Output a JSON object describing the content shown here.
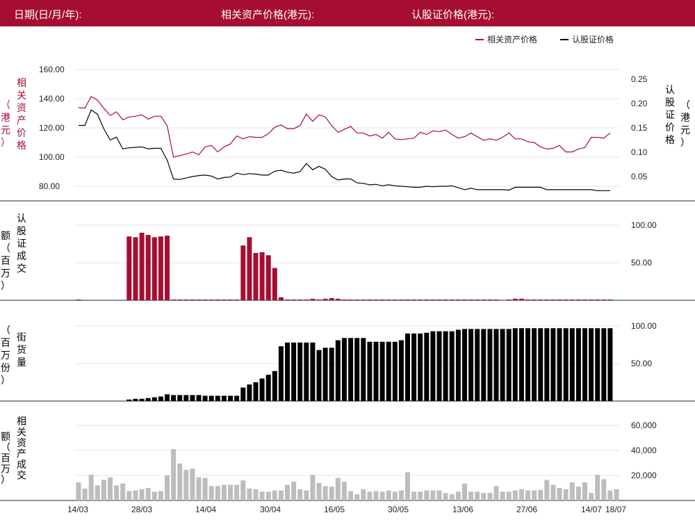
{
  "header": {
    "date_label": "日期(日/月/年):",
    "asset_label": "相关资产价格(港元):",
    "warrant_label": "认股证价格(港元):"
  },
  "colors": {
    "brand": "#a50e32",
    "black": "#000000",
    "gray": "#bdbdbd"
  },
  "chart_data": [
    {
      "type": "line",
      "title": "",
      "legend": {
        "placement": "top-right",
        "entries": [
          "相关资产价格",
          "认股证价格"
        ]
      },
      "ylabel_left": "相关资产价格（港元）",
      "ylabel_right": "认股证价格（港元）",
      "yticks_left": [
        "80.00",
        "100.00",
        "120.00",
        "140.00",
        "160.00"
      ],
      "yticks_right": [
        "0.05",
        "0.10",
        "0.15",
        "0.20",
        "0.25"
      ],
      "ylim_left": [
        70,
        170
      ],
      "ylim_right": [
        0,
        0.3
      ],
      "grid": true,
      "series": [
        {
          "name": "相关资产价格",
          "axis": "left",
          "color": "#a50e32",
          "values": [
            134,
            133.5,
            141.5,
            139,
            133.5,
            128.5,
            131,
            125.5,
            127.5,
            128,
            129,
            126,
            128,
            128,
            121.5,
            100,
            101,
            102,
            103.5,
            101.5,
            107,
            108,
            103.5,
            107,
            109,
            114.5,
            112.5,
            114,
            113.5,
            113.5,
            116,
            120.5,
            122,
            119.5,
            119.5,
            121.5,
            129.5,
            124.5,
            129,
            127.5,
            121.5,
            117,
            119,
            121,
            116.5,
            116.5,
            114.5,
            115.5,
            113,
            117,
            112.5,
            112,
            112.5,
            113,
            117,
            115.5,
            118,
            117.5,
            118.5,
            115.5,
            113,
            114,
            116.5,
            114,
            111.5,
            112.5,
            111.5,
            113.5,
            116.5,
            112.5,
            112.5,
            110.5,
            110,
            107,
            105.5,
            106,
            108,
            103.5,
            103.5,
            105.5,
            106.5,
            113.5,
            113.5,
            113,
            116.5
          ]
        },
        {
          "name": "认股证价格",
          "axis": "left",
          "color": "#000000",
          "values": [
            0.155,
            0.155,
            0.187,
            0.178,
            0.148,
            0.125,
            0.131,
            0.107,
            0.109,
            0.11,
            0.111,
            0.107,
            0.108,
            0.108,
            0.084,
            0.045,
            0.044,
            0.047,
            0.05,
            0.052,
            0.053,
            0.051,
            0.045,
            0.048,
            0.049,
            0.057,
            0.054,
            0.056,
            0.055,
            0.053,
            0.053,
            0.061,
            0.063,
            0.059,
            0.057,
            0.06,
            0.077,
            0.064,
            0.071,
            0.065,
            0.05,
            0.043,
            0.045,
            0.045,
            0.037,
            0.036,
            0.033,
            0.034,
            0.031,
            0.033,
            0.031,
            0.03,
            0.029,
            0.028,
            0.028,
            0.03,
            0.029,
            0.03,
            0.03,
            0.031,
            0.027,
            0.023,
            0.026,
            0.023,
            0.023,
            0.023,
            0.023,
            0.023,
            0.022,
            0.028,
            0.028,
            0.028,
            0.028,
            0.028,
            0.023,
            0.023,
            0.023,
            0.023,
            0.023,
            0.023,
            0.023,
            0.023,
            0.021,
            0.021,
            0.021
          ]
        }
      ]
    },
    {
      "type": "bar",
      "title": "",
      "ylabel": "认股证成交额（百万）",
      "yticks": [
        "50.00",
        "100.00"
      ],
      "ylim": [
        0,
        120
      ],
      "color": "#a50e32",
      "values": [
        1,
        0,
        0,
        0,
        0,
        0,
        0,
        0,
        85,
        84,
        90,
        87,
        84,
        85,
        86,
        1,
        1,
        1,
        1,
        1,
        1,
        1,
        1,
        1,
        1,
        1,
        73,
        84,
        63,
        64,
        60,
        43,
        4,
        1,
        1,
        1,
        1,
        2,
        1,
        2,
        3,
        2,
        1,
        1,
        1,
        1,
        1,
        1,
        1,
        1,
        1,
        1,
        1,
        1,
        1,
        1,
        1,
        1,
        1,
        1,
        1,
        1,
        1,
        1,
        1,
        1,
        1,
        0,
        1,
        2,
        2,
        1,
        1,
        1,
        1,
        1,
        1,
        1,
        1,
        1,
        1,
        1,
        1,
        1,
        1
      ]
    },
    {
      "type": "bar",
      "title": "",
      "ylabel": "街货量（百万份）",
      "yticks": [
        "50.00",
        "100.00"
      ],
      "ylim": [
        0,
        120
      ],
      "color": "#000000",
      "values": [
        0,
        0,
        0,
        0,
        0,
        0,
        0,
        0,
        2,
        3,
        3,
        4,
        5,
        6,
        9,
        8,
        8,
        8,
        8,
        8,
        7,
        7,
        7,
        7,
        7,
        7,
        18,
        22,
        25,
        30,
        35,
        40,
        73,
        78,
        78,
        78,
        78,
        78,
        68,
        71,
        71,
        81,
        84,
        84,
        84,
        84,
        79,
        79,
        79,
        79,
        79,
        81,
        90,
        90,
        90,
        91,
        93,
        93,
        93,
        93,
        95,
        96,
        96,
        96,
        96,
        96,
        96,
        96,
        96,
        97,
        97,
        97,
        97,
        97,
        97,
        97,
        97,
        97,
        97,
        97,
        97,
        97,
        97,
        97,
        97
      ]
    },
    {
      "type": "bar",
      "title": "",
      "ylabel": "相关资产成交额（百万）",
      "yticks": [
        "20,000",
        "40,000",
        "60,000"
      ],
      "ylim": [
        0,
        70000
      ],
      "color": "#bdbdbd",
      "categories": [
        "14/03",
        "",
        "",
        "",
        "",
        "",
        "",
        "",
        "28/03",
        "",
        "",
        "",
        "",
        "",
        "",
        "",
        "",
        "",
        "",
        "",
        "14/04",
        "",
        "",
        "",
        "",
        "",
        "",
        "",
        "",
        "",
        "",
        "",
        "30/04",
        "",
        "",
        "",
        "",
        "",
        "",
        "",
        "",
        "",
        "16/05",
        "",
        "",
        "",
        "",
        "",
        "",
        "",
        "",
        "",
        "",
        "30/05",
        "",
        "",
        "",
        "",
        "",
        "",
        "",
        "",
        "",
        "13/06",
        "",
        "",
        "",
        "",
        "",
        "",
        "",
        "",
        "",
        "27/06",
        "",
        "",
        "",
        "",
        "",
        "",
        "",
        "",
        "14/07",
        "",
        "",
        "18/07"
      ],
      "xtick_labels": [
        "14/03",
        "28/03",
        "14/04",
        "30/04",
        "16/05",
        "30/05",
        "13/06",
        "27/06",
        "14/07",
        "18/07"
      ],
      "values": [
        14500,
        9500,
        20500,
        12000,
        16500,
        18500,
        12000,
        13500,
        7500,
        8000,
        9000,
        10000,
        7000,
        7500,
        20000,
        41000,
        29500,
        24500,
        25500,
        18500,
        18000,
        11500,
        11500,
        12500,
        12500,
        12500,
        16000,
        9500,
        9000,
        7000,
        7000,
        8000,
        8000,
        12500,
        15000,
        9000,
        8000,
        20500,
        14000,
        11500,
        11000,
        18000,
        15000,
        7500,
        5000,
        9000,
        7000,
        7500,
        7000,
        8000,
        7000,
        8000,
        22500,
        7000,
        7000,
        8000,
        8000,
        8000,
        6000,
        5000,
        7000,
        13500,
        7000,
        7000,
        6000,
        6000,
        11500,
        7000,
        7000,
        8000,
        9000,
        8000,
        8000,
        8500,
        16500,
        12500,
        10000,
        9000,
        14500,
        11000,
        14500,
        6000,
        20500,
        17000,
        8000,
        9000
      ]
    }
  ]
}
